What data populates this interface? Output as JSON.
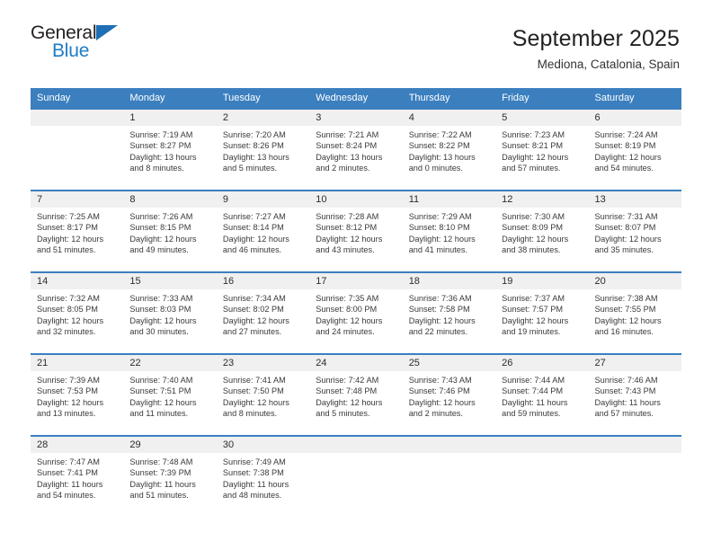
{
  "brand": {
    "name_top": "General",
    "name_bottom": "Blue",
    "triangle_color": "#1e6fb3",
    "blue_color": "#1d7cc4"
  },
  "header": {
    "title": "September 2025",
    "subtitle": "Mediona, Catalonia, Spain"
  },
  "theme": {
    "header_blue": "#3b7fbf",
    "date_band_gray": "#f0f0f0",
    "text_color": "#3a3a3a"
  },
  "weekdays": [
    "Sunday",
    "Monday",
    "Tuesday",
    "Wednesday",
    "Thursday",
    "Friday",
    "Saturday"
  ],
  "weeks": [
    [
      {
        "day": "",
        "empty": true,
        "l1": "",
        "l2": "",
        "l3": "",
        "l4": ""
      },
      {
        "day": "1",
        "l1": "Sunrise: 7:19 AM",
        "l2": "Sunset: 8:27 PM",
        "l3": "Daylight: 13 hours",
        "l4": "and 8 minutes."
      },
      {
        "day": "2",
        "l1": "Sunrise: 7:20 AM",
        "l2": "Sunset: 8:26 PM",
        "l3": "Daylight: 13 hours",
        "l4": "and 5 minutes."
      },
      {
        "day": "3",
        "l1": "Sunrise: 7:21 AM",
        "l2": "Sunset: 8:24 PM",
        "l3": "Daylight: 13 hours",
        "l4": "and 2 minutes."
      },
      {
        "day": "4",
        "l1": "Sunrise: 7:22 AM",
        "l2": "Sunset: 8:22 PM",
        "l3": "Daylight: 13 hours",
        "l4": "and 0 minutes."
      },
      {
        "day": "5",
        "l1": "Sunrise: 7:23 AM",
        "l2": "Sunset: 8:21 PM",
        "l3": "Daylight: 12 hours",
        "l4": "and 57 minutes."
      },
      {
        "day": "6",
        "l1": "Sunrise: 7:24 AM",
        "l2": "Sunset: 8:19 PM",
        "l3": "Daylight: 12 hours",
        "l4": "and 54 minutes."
      }
    ],
    [
      {
        "day": "7",
        "l1": "Sunrise: 7:25 AM",
        "l2": "Sunset: 8:17 PM",
        "l3": "Daylight: 12 hours",
        "l4": "and 51 minutes."
      },
      {
        "day": "8",
        "l1": "Sunrise: 7:26 AM",
        "l2": "Sunset: 8:15 PM",
        "l3": "Daylight: 12 hours",
        "l4": "and 49 minutes."
      },
      {
        "day": "9",
        "l1": "Sunrise: 7:27 AM",
        "l2": "Sunset: 8:14 PM",
        "l3": "Daylight: 12 hours",
        "l4": "and 46 minutes."
      },
      {
        "day": "10",
        "l1": "Sunrise: 7:28 AM",
        "l2": "Sunset: 8:12 PM",
        "l3": "Daylight: 12 hours",
        "l4": "and 43 minutes."
      },
      {
        "day": "11",
        "l1": "Sunrise: 7:29 AM",
        "l2": "Sunset: 8:10 PM",
        "l3": "Daylight: 12 hours",
        "l4": "and 41 minutes."
      },
      {
        "day": "12",
        "l1": "Sunrise: 7:30 AM",
        "l2": "Sunset: 8:09 PM",
        "l3": "Daylight: 12 hours",
        "l4": "and 38 minutes."
      },
      {
        "day": "13",
        "l1": "Sunrise: 7:31 AM",
        "l2": "Sunset: 8:07 PM",
        "l3": "Daylight: 12 hours",
        "l4": "and 35 minutes."
      }
    ],
    [
      {
        "day": "14",
        "l1": "Sunrise: 7:32 AM",
        "l2": "Sunset: 8:05 PM",
        "l3": "Daylight: 12 hours",
        "l4": "and 32 minutes."
      },
      {
        "day": "15",
        "l1": "Sunrise: 7:33 AM",
        "l2": "Sunset: 8:03 PM",
        "l3": "Daylight: 12 hours",
        "l4": "and 30 minutes."
      },
      {
        "day": "16",
        "l1": "Sunrise: 7:34 AM",
        "l2": "Sunset: 8:02 PM",
        "l3": "Daylight: 12 hours",
        "l4": "and 27 minutes."
      },
      {
        "day": "17",
        "l1": "Sunrise: 7:35 AM",
        "l2": "Sunset: 8:00 PM",
        "l3": "Daylight: 12 hours",
        "l4": "and 24 minutes."
      },
      {
        "day": "18",
        "l1": "Sunrise: 7:36 AM",
        "l2": "Sunset: 7:58 PM",
        "l3": "Daylight: 12 hours",
        "l4": "and 22 minutes."
      },
      {
        "day": "19",
        "l1": "Sunrise: 7:37 AM",
        "l2": "Sunset: 7:57 PM",
        "l3": "Daylight: 12 hours",
        "l4": "and 19 minutes."
      },
      {
        "day": "20",
        "l1": "Sunrise: 7:38 AM",
        "l2": "Sunset: 7:55 PM",
        "l3": "Daylight: 12 hours",
        "l4": "and 16 minutes."
      }
    ],
    [
      {
        "day": "21",
        "l1": "Sunrise: 7:39 AM",
        "l2": "Sunset: 7:53 PM",
        "l3": "Daylight: 12 hours",
        "l4": "and 13 minutes."
      },
      {
        "day": "22",
        "l1": "Sunrise: 7:40 AM",
        "l2": "Sunset: 7:51 PM",
        "l3": "Daylight: 12 hours",
        "l4": "and 11 minutes."
      },
      {
        "day": "23",
        "l1": "Sunrise: 7:41 AM",
        "l2": "Sunset: 7:50 PM",
        "l3": "Daylight: 12 hours",
        "l4": "and 8 minutes."
      },
      {
        "day": "24",
        "l1": "Sunrise: 7:42 AM",
        "l2": "Sunset: 7:48 PM",
        "l3": "Daylight: 12 hours",
        "l4": "and 5 minutes."
      },
      {
        "day": "25",
        "l1": "Sunrise: 7:43 AM",
        "l2": "Sunset: 7:46 PM",
        "l3": "Daylight: 12 hours",
        "l4": "and 2 minutes."
      },
      {
        "day": "26",
        "l1": "Sunrise: 7:44 AM",
        "l2": "Sunset: 7:44 PM",
        "l3": "Daylight: 11 hours",
        "l4": "and 59 minutes."
      },
      {
        "day": "27",
        "l1": "Sunrise: 7:46 AM",
        "l2": "Sunset: 7:43 PM",
        "l3": "Daylight: 11 hours",
        "l4": "and 57 minutes."
      }
    ],
    [
      {
        "day": "28",
        "l1": "Sunrise: 7:47 AM",
        "l2": "Sunset: 7:41 PM",
        "l3": "Daylight: 11 hours",
        "l4": "and 54 minutes."
      },
      {
        "day": "29",
        "l1": "Sunrise: 7:48 AM",
        "l2": "Sunset: 7:39 PM",
        "l3": "Daylight: 11 hours",
        "l4": "and 51 minutes."
      },
      {
        "day": "30",
        "l1": "Sunrise: 7:49 AM",
        "l2": "Sunset: 7:38 PM",
        "l3": "Daylight: 11 hours",
        "l4": "and 48 minutes."
      },
      {
        "day": "",
        "empty": true,
        "l1": "",
        "l2": "",
        "l3": "",
        "l4": ""
      },
      {
        "day": "",
        "empty": true,
        "l1": "",
        "l2": "",
        "l3": "",
        "l4": ""
      },
      {
        "day": "",
        "empty": true,
        "l1": "",
        "l2": "",
        "l3": "",
        "l4": ""
      },
      {
        "day": "",
        "empty": true,
        "l1": "",
        "l2": "",
        "l3": "",
        "l4": ""
      }
    ]
  ]
}
